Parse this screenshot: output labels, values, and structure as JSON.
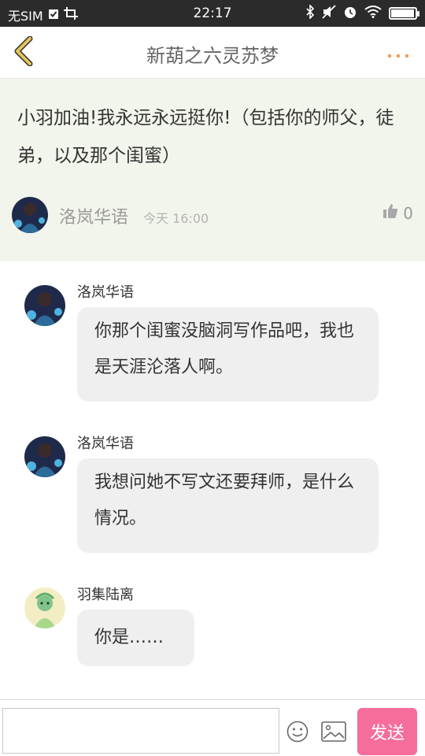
{
  "status_bar": {
    "carrier": "无SIM",
    "time": "22:17",
    "battery_level_percent": 95
  },
  "nav": {
    "title": "新葫之六灵苏梦",
    "more_icon": "more-dots-icon",
    "back_icon": "back-chevron-icon",
    "back_color": "#e7c65a",
    "more_color": "#f59b4d"
  },
  "post": {
    "text": "小羽加油!我永远永远挺你!（包括你的师父，徒弟，以及那个闺蜜）",
    "author": "洛岚华语",
    "time": "今天 16:00",
    "likes": "0",
    "background": "#f2f5ec"
  },
  "comments": [
    {
      "author": "洛岚华语",
      "text": "你那个闺蜜没脑洞写作品吧，我也是天涯沦落人啊。"
    },
    {
      "author": "洛岚华语",
      "text": "我想问她不写文还要拜师，是什么情况。"
    },
    {
      "author": "羽集陆离",
      "text": "你是……"
    }
  ],
  "composer": {
    "input_value": "",
    "send_label": "发送",
    "send_color": "#f56e9b"
  }
}
